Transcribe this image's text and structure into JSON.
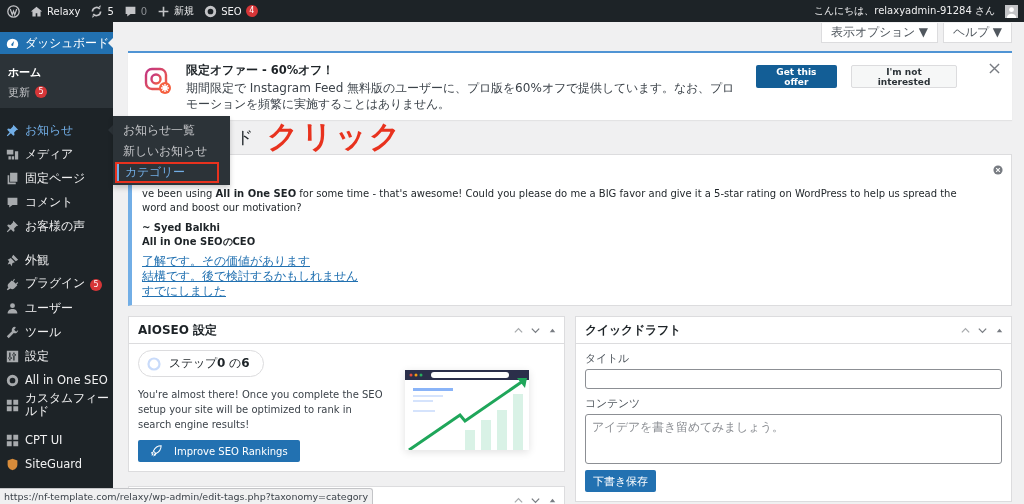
{
  "admin_bar": {
    "site": "Relaxy",
    "updates": "5",
    "comments": "0",
    "new": "新規",
    "seo": "SEO",
    "seo_count": "4",
    "greeting": "こんにちは、relaxyadmin-91284 さん"
  },
  "sidebar": {
    "items": [
      {
        "label": "ダッシュボード",
        "selected": true,
        "hovered": false,
        "children": [
          {
            "label": "ホーム",
            "selected": true
          },
          {
            "label": "更新",
            "selected": false,
            "badge": "5"
          }
        ]
      },
      {
        "label": "お知らせ",
        "selected": false,
        "hovered": true
      },
      {
        "label": "メディア",
        "selected": false,
        "hovered": false
      },
      {
        "label": "固定ページ",
        "selected": false,
        "hovered": false
      },
      {
        "label": "コメント",
        "selected": false,
        "hovered": false
      },
      {
        "label": "お客様の声",
        "selected": false,
        "hovered": false
      },
      {
        "label": "外観",
        "selected": false,
        "hovered": false
      },
      {
        "label": "プラグイン",
        "selected": false,
        "hovered": false,
        "badge": "5"
      },
      {
        "label": "ユーザー",
        "selected": false,
        "hovered": false
      },
      {
        "label": "ツール",
        "selected": false,
        "hovered": false
      },
      {
        "label": "設定",
        "selected": false,
        "hovered": false
      },
      {
        "label": "All in One SEO",
        "selected": false,
        "hovered": false
      },
      {
        "label": "カスタムフィールド",
        "selected": false,
        "hovered": false
      },
      {
        "label": "CPT UI",
        "selected": false,
        "hovered": false
      },
      {
        "label": "SiteGuard",
        "selected": false,
        "hovered": false
      }
    ]
  },
  "flyout": {
    "items": [
      {
        "label": "お知らせ一覧",
        "selected": false,
        "boxed": false
      },
      {
        "label": "新しいお知らせ",
        "selected": false,
        "boxed": false
      },
      {
        "label": "カテゴリー",
        "selected": true,
        "boxed": true
      }
    ]
  },
  "screen_buttons": [
    "表示オプション ▼",
    "ヘルプ ▼"
  ],
  "promo": {
    "title": "限定オファー - 60%オフ！",
    "text": "期間限定で Instagram Feed 無料版のユーザーに、プロ版を60%オフで提供しています。なお、プロモーションを頻繁に実施することはありません。",
    "primary": "Get this offer",
    "secondary": "I'm not interested"
  },
  "heading": "ド",
  "annotation": "クリック",
  "review_notice": {
    "text": "ve been using **All in One SEO** for some time - that's awesome! Could you please do me a BIG favor and give it a 5-star rating on WordPress to help us spread the word and boost our motivation?",
    "author": "~ Syed Balkhi",
    "role": "All in One SEOのCEO",
    "links": [
      "了解です。その価値があります",
      "結構です。後で検討するかもしれません",
      "すでにしました"
    ]
  },
  "aioseo_widget": {
    "title": "AIOSEO 設定",
    "step": "ステップ**0** の**6**",
    "text": "You're almost there! Once you complete the SEO setup your site will be optimized to rank in search engine results!",
    "button": "Improve SEO Rankings"
  },
  "quick_draft": {
    "title": "クイックドラフト",
    "title_label": "タイトル",
    "content_label": "コンテンツ",
    "content_placeholder": "アイデアを書き留めてみましょう。",
    "save": "下書き保存"
  },
  "status_url": "https://nf-template.com/relaxy/wp-admin/edit-tags.php?taxonomy=category"
}
